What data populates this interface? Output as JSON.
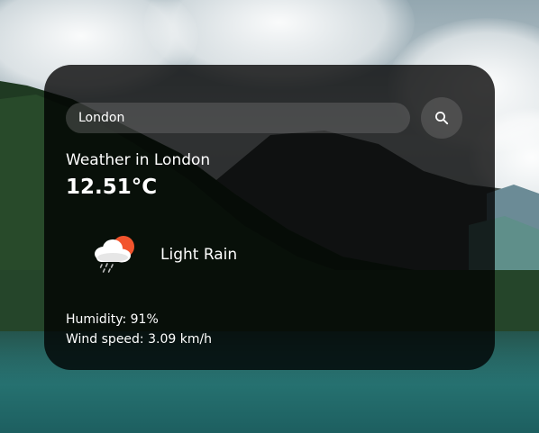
{
  "search": {
    "value": "London",
    "placeholder": "Search"
  },
  "weather": {
    "title": "Weather in London",
    "temperature": "12.51°C",
    "description": "Light Rain",
    "icon": "light-rain-icon",
    "humidity": "Humidity: 91%",
    "wind": "Wind speed: 3.09 km/h"
  },
  "colors": {
    "card_background": "rgba(0,0,0,0.78)",
    "text": "#ffffff",
    "sun": "#f2542d"
  }
}
